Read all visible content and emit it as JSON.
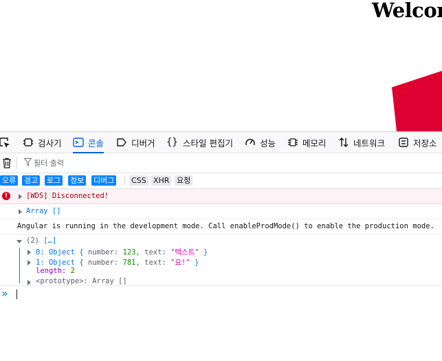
{
  "page": {
    "heading": "Welcom",
    "logo_color": "#dd0031"
  },
  "devtools": {
    "tabs": [
      {
        "label": "검사기",
        "icon": "inspector-icon"
      },
      {
        "label": "콘솔",
        "icon": "console-icon",
        "selected": true
      },
      {
        "label": "디버거",
        "icon": "debugger-icon"
      },
      {
        "label": "스타일 편집기",
        "icon": "style-editor-icon"
      },
      {
        "label": "성능",
        "icon": "performance-icon"
      },
      {
        "label": "메모리",
        "icon": "memory-icon"
      },
      {
        "label": "네트워크",
        "icon": "network-icon"
      },
      {
        "label": "저장소",
        "icon": "storage-icon"
      }
    ],
    "filter_placeholder": "필터 출력",
    "levels": [
      "오류",
      "경고",
      "로그",
      "정보",
      "디버그"
    ],
    "requests": [
      "CSS",
      "XHR",
      "요청"
    ],
    "accent_color": "#0060df",
    "messages": {
      "error": "[WDS] Disconnected!",
      "array_empty": "Array []",
      "angular": "Angular is running in the development mode. Call enableProdMode() to enable the production mode.",
      "obj_header_count": "(2)",
      "obj_header_rest": "[…]",
      "item0": {
        "index": "0:",
        "type": "Object",
        "key1": "number:",
        "val1": "123",
        "key2": "text:",
        "val2": "\"텍스트\""
      },
      "item1": {
        "index": "1:",
        "type": "Object",
        "key1": "number:",
        "val1": "781",
        "key2": "text:",
        "val2": "\"요!\""
      },
      "length_key": "length:",
      "length_val": "2",
      "prototype": "<prototype>: Array []"
    },
    "prompt_symbol": "»"
  }
}
